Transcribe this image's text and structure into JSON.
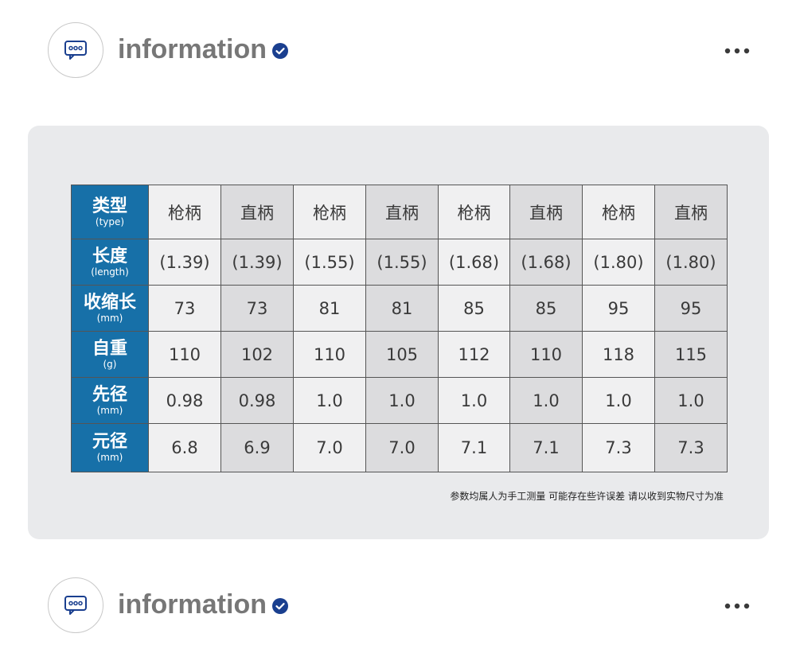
{
  "headers": [
    {
      "title": "information"
    },
    {
      "title": "information"
    }
  ],
  "table": {
    "columns": [
      "枪柄",
      "直柄",
      "枪柄",
      "直柄",
      "枪柄",
      "直柄",
      "枪柄",
      "直柄"
    ],
    "rows": [
      {
        "label": "类型",
        "sub": "(type)",
        "cells": [
          "枪柄",
          "直柄",
          "枪柄",
          "直柄",
          "枪柄",
          "直柄",
          "枪柄",
          "直柄"
        ]
      },
      {
        "label": "长度",
        "sub": "(length)",
        "cells": [
          "(1.39)",
          "(1.39)",
          "(1.55)",
          "(1.55)",
          "(1.68)",
          "(1.68)",
          "(1.80)",
          "(1.80)"
        ]
      },
      {
        "label": "收缩长",
        "sub": "(mm)",
        "cells": [
          "73",
          "73",
          "81",
          "81",
          "85",
          "85",
          "95",
          "95"
        ]
      },
      {
        "label": "自重",
        "sub": "(g)",
        "cells": [
          "110",
          "102",
          "110",
          "105",
          "112",
          "110",
          "118",
          "115"
        ]
      },
      {
        "label": "先径",
        "sub": "(mm)",
        "cells": [
          "0.98",
          "0.98",
          "1.0",
          "1.0",
          "1.0",
          "1.0",
          "1.0",
          "1.0"
        ]
      },
      {
        "label": "元径",
        "sub": "(mm)",
        "cells": [
          "6.8",
          "6.9",
          "7.0",
          "7.0",
          "7.1",
          "7.1",
          "7.3",
          "7.3"
        ]
      }
    ]
  },
  "note": "参数均属人为手工测量 可能存在些许误差 请以收到实物尺寸为准",
  "colors": {
    "header_bg": "#1770a8",
    "verified": "#1a3f8f",
    "title": "#777777"
  },
  "icons": [
    "chat-bubble-icon",
    "verified-check-icon",
    "more-options-icon"
  ]
}
